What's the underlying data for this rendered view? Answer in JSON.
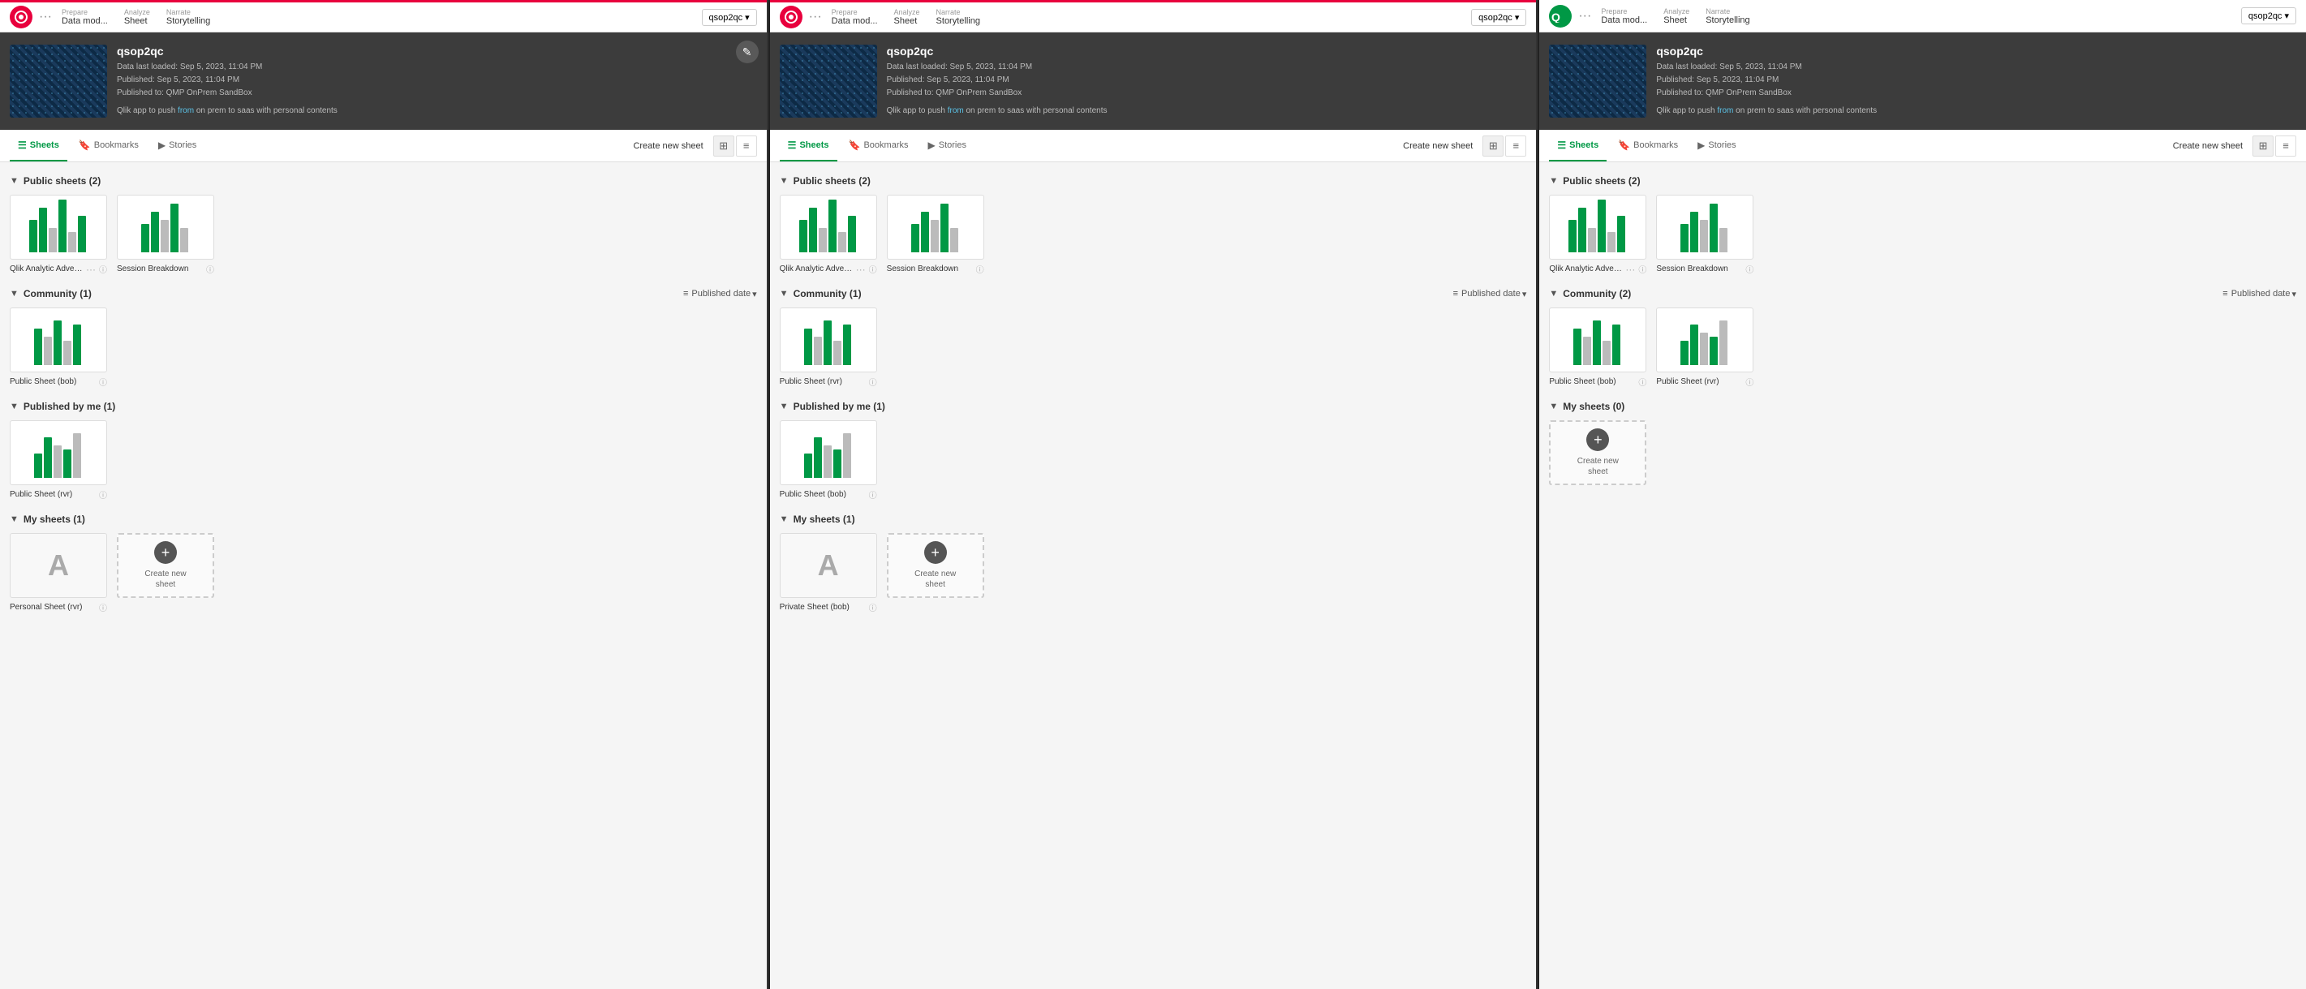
{
  "panels": [
    {
      "id": "panel1",
      "topbar": {
        "logoColor": "red",
        "dots": "···",
        "prepare_label": "Prepare",
        "prepare_value": "Data mod...",
        "analyze_label": "Analyze",
        "analyze_value": "Sheet",
        "narrate_label": "Narrate",
        "narrate_value": "Storytelling",
        "app_btn": "qsop2qc ▾",
        "red_accent": true
      },
      "app": {
        "name": "qsop2qc",
        "meta_line1": "Data last loaded: Sep 5, 2023, 11:04 PM",
        "meta_line2": "Published: Sep 5, 2023, 11:04 PM",
        "meta_line3": "Published to: QMP OnPrem SandBox",
        "description": "Qlik app to push from on prem to saas with personal contents",
        "edit_icon": "✎"
      },
      "tabs": {
        "items": [
          {
            "id": "sheets",
            "label": "Sheets",
            "icon": "☰",
            "active": true
          },
          {
            "id": "bookmarks",
            "label": "Bookmarks",
            "icon": "🔖",
            "active": false
          },
          {
            "id": "stories",
            "label": "Stories",
            "icon": "▶",
            "active": false
          }
        ],
        "create_btn": "Create new sheet",
        "view_grid": "⊞",
        "view_list": "≡"
      },
      "sections": [
        {
          "id": "public",
          "title": "Public sheets",
          "count": 2,
          "sheets": [
            {
              "id": "qlik-analytic",
              "label": "Qlik Analytic Adventure",
              "has_more": true,
              "has_info": true,
              "type": "chart1"
            },
            {
              "id": "session-breakdown",
              "label": "Session Breakdown",
              "has_info": true,
              "type": "chart2"
            }
          ],
          "sort": null
        },
        {
          "id": "community",
          "title": "Community",
          "count": 1,
          "sheets": [
            {
              "id": "public-sheet-bob",
              "label": "Public Sheet (bob)",
              "has_info": true,
              "type": "chart3"
            }
          ],
          "sort": "Published date"
        },
        {
          "id": "published-by-me",
          "title": "Published by me",
          "count": 1,
          "sheets": [
            {
              "id": "public-sheet-rvr",
              "label": "Public Sheet (rvr)",
              "has_info": true,
              "type": "chart4"
            }
          ],
          "sort": null
        },
        {
          "id": "my-sheets",
          "title": "My sheets",
          "count": 1,
          "sheets": [
            {
              "id": "personal-sheet",
              "label": "Personal Sheet (rvr)",
              "has_info": true,
              "type": "private"
            },
            {
              "id": "create-new",
              "label": "Create new sheet",
              "type": "new"
            }
          ],
          "sort": null
        }
      ]
    },
    {
      "id": "panel2",
      "topbar": {
        "logoColor": "red",
        "dots": "···",
        "prepare_label": "Prepare",
        "prepare_value": "Data mod...",
        "analyze_label": "Analyze",
        "analyze_value": "Sheet",
        "narrate_label": "Narrate",
        "narrate_value": "Storytelling",
        "app_btn": "qsop2qc ▾",
        "red_accent": true
      },
      "app": {
        "name": "qsop2qc",
        "meta_line1": "Data last loaded: Sep 5, 2023, 11:04 PM",
        "meta_line2": "Published: Sep 5, 2023, 11:04 PM",
        "meta_line3": "Published to: QMP OnPrem SandBox",
        "description": "Qlik app to push from on prem to saas with personal contents",
        "edit_icon": ""
      },
      "tabs": {
        "items": [
          {
            "id": "sheets",
            "label": "Sheets",
            "icon": "☰",
            "active": true
          },
          {
            "id": "bookmarks",
            "label": "Bookmarks",
            "icon": "🔖",
            "active": false
          },
          {
            "id": "stories",
            "label": "Stories",
            "icon": "▶",
            "active": false
          }
        ],
        "create_btn": "Create new sheet",
        "view_grid": "⊞",
        "view_list": "≡"
      },
      "sections": [
        {
          "id": "public",
          "title": "Public sheets",
          "count": 2,
          "sheets": [
            {
              "id": "qlik-analytic",
              "label": "Qlik Analytic Adventure",
              "has_more": true,
              "has_info": true,
              "type": "chart1"
            },
            {
              "id": "session-breakdown",
              "label": "Session Breakdown",
              "has_info": true,
              "type": "chart2"
            }
          ],
          "sort": null
        },
        {
          "id": "community",
          "title": "Community",
          "count": 1,
          "sheets": [
            {
              "id": "public-sheet-rvr",
              "label": "Public Sheet (rvr)",
              "has_info": true,
              "type": "chart3"
            }
          ],
          "sort": "Published date"
        },
        {
          "id": "published-by-me",
          "title": "Published by me",
          "count": 1,
          "sheets": [
            {
              "id": "public-sheet-bob",
              "label": "Public Sheet (bob)",
              "has_info": true,
              "type": "chart4"
            }
          ],
          "sort": null
        },
        {
          "id": "my-sheets",
          "title": "My sheets",
          "count": 1,
          "sheets": [
            {
              "id": "private-sheet-bob",
              "label": "Private Sheet (bob)",
              "has_info": true,
              "type": "private"
            },
            {
              "id": "create-new",
              "label": "Create new sheet",
              "type": "new"
            }
          ],
          "sort": null
        }
      ]
    },
    {
      "id": "panel3",
      "topbar": {
        "logoColor": "green",
        "dots": "···",
        "prepare_label": "Prepare",
        "prepare_value": "Data mod...",
        "analyze_label": "Analyze",
        "analyze_value": "Sheet",
        "narrate_label": "Narrate",
        "narrate_value": "Storytelling",
        "app_btn": "qsop2qc ▾",
        "red_accent": false
      },
      "app": {
        "name": "qsop2qc",
        "meta_line1": "Data last loaded: Sep 5, 2023, 11:04 PM",
        "meta_line2": "Published: Sep 5, 2023, 11:04 PM",
        "meta_line3": "Published to: QMP OnPrem SandBox",
        "description": "Qlik app to push from on prem to saas with personal contents",
        "edit_icon": ""
      },
      "tabs": {
        "items": [
          {
            "id": "sheets",
            "label": "Sheets",
            "icon": "☰",
            "active": true
          },
          {
            "id": "bookmarks",
            "label": "Bookmarks",
            "icon": "🔖",
            "active": false
          },
          {
            "id": "stories",
            "label": "Stories",
            "icon": "▶",
            "active": false
          }
        ],
        "create_btn": "Create new sheet",
        "view_grid": "⊞",
        "view_list": "≡"
      },
      "sections": [
        {
          "id": "public",
          "title": "Public sheets",
          "count": 2,
          "sheets": [
            {
              "id": "qlik-analytic",
              "label": "Qlik Analytic Adventure",
              "has_more": true,
              "has_info": true,
              "type": "chart1"
            },
            {
              "id": "session-breakdown",
              "label": "Session Breakdown",
              "has_info": true,
              "type": "chart2"
            }
          ],
          "sort": null
        },
        {
          "id": "community",
          "title": "Community",
          "count": 2,
          "sheets": [
            {
              "id": "public-sheet-bob",
              "label": "Public Sheet (bob)",
              "has_info": true,
              "type": "chart3"
            },
            {
              "id": "public-sheet-rvr",
              "label": "Public Sheet (rvr)",
              "has_info": true,
              "type": "chart4"
            }
          ],
          "sort": "Published date"
        },
        {
          "id": "my-sheets",
          "title": "My sheets",
          "count": 0,
          "sheets": [
            {
              "id": "create-new",
              "label": "Create new sheet",
              "type": "new"
            }
          ],
          "sort": null
        }
      ]
    }
  ],
  "chart_types": {
    "chart1": {
      "bars": [
        40,
        55,
        30,
        65,
        25,
        45
      ],
      "colors": [
        "green",
        "green",
        "gray",
        "green",
        "gray",
        "green"
      ]
    },
    "chart2": {
      "bars": [
        35,
        50,
        40,
        60,
        30
      ],
      "colors": [
        "green",
        "green",
        "gray",
        "green",
        "gray"
      ]
    },
    "chart3": {
      "bars": [
        45,
        35,
        55,
        30,
        50
      ],
      "colors": [
        "green",
        "gray",
        "green",
        "gray",
        "green"
      ]
    },
    "chart4": {
      "bars": [
        30,
        50,
        40,
        35,
        55
      ],
      "colors": [
        "green",
        "green",
        "gray",
        "green",
        "gray"
      ]
    }
  }
}
